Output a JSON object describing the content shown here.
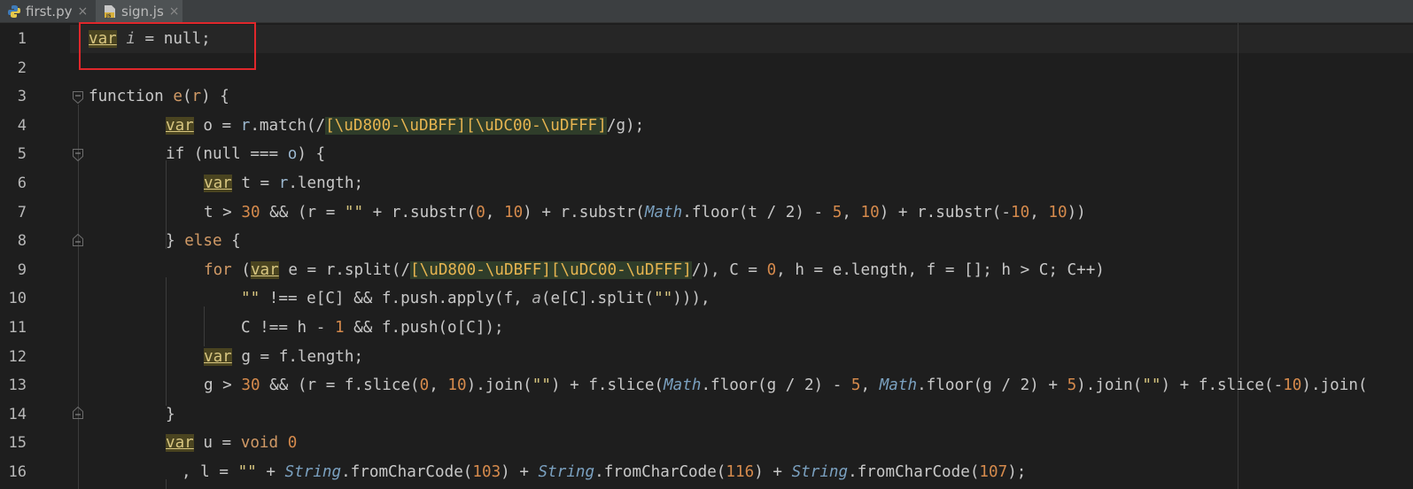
{
  "tabs": [
    {
      "label": "first.py",
      "icon": "python-file-icon",
      "close": "×",
      "active": false
    },
    {
      "label": "sign.js",
      "icon": "js-file-icon",
      "close": "×",
      "active": true
    }
  ],
  "line_numbers": [
    "1",
    "2",
    "3",
    "4",
    "5",
    "6",
    "7",
    "8",
    "9",
    "10",
    "11",
    "12",
    "13",
    "14",
    "15",
    "16"
  ],
  "code": {
    "l1": {
      "kw": "var",
      "id": "i",
      "rest": " = null;"
    },
    "l3": {
      "a": "function ",
      "b": "e",
      "c": "(",
      "d": "r",
      "e": ") {"
    },
    "l4": {
      "kw": "var",
      "a": " o = ",
      "b": "r",
      "c": ".match(/",
      "rx": "[\\uD800-\\uDBFF][\\uDC00-\\uDFFF]",
      "d": "/g);"
    },
    "l5": {
      "a": "if",
      "b": " (null === ",
      "c": "o",
      "d": ") {"
    },
    "l6": {
      "kw": "var",
      "a": " t = ",
      "b": "r",
      "c": ".length;"
    },
    "l7": {
      "a": "t > ",
      "n1": "30",
      "b": " && (r = ",
      "s1": "\"\"",
      "c": " + r.substr(",
      "n2": "0",
      "d": ", ",
      "n3": "10",
      "e": ") + r.substr(",
      "cls": "Math",
      "f": ".floor(t / 2) - ",
      "n4": "5",
      "g": ", ",
      "n5": "10",
      "h": ") + r.substr(-",
      "n6": "10",
      "i": ", ",
      "n7": "10",
      "j": "))"
    },
    "l8": {
      "a": "} ",
      "b": "else",
      "c": " {"
    },
    "l9": {
      "a": "for",
      "b": " (",
      "kw": "var",
      "c": " e = r.split(/",
      "rx": "[\\uD800-\\uDBFF][\\uDC00-\\uDFFF]",
      "d": "/), C = ",
      "n1": "0",
      "e": ", h = e.length, f = []; h > C; C++)"
    },
    "l10": {
      "s1": "\"\"",
      "a": " !== e[C] && f.push.apply(f, ",
      "it": "a",
      "b": "(e[C].split(",
      "s2": "\"\"",
      "c": "))),"
    },
    "l11": {
      "a": "C !== h - ",
      "n1": "1",
      "b": " && f.push(o[C]);"
    },
    "l12": {
      "kw": "var",
      "a": " g = f.length;"
    },
    "l13": {
      "a": "g > ",
      "n1": "30",
      "b": " && (r = f.slice(",
      "n2": "0",
      "c": ", ",
      "n3": "10",
      "d": ").join(",
      "s1": "\"\"",
      "e": ") + f.slice(",
      "cls1": "Math",
      "f": ".floor(g / 2) - ",
      "n4": "5",
      "g": ", ",
      "cls2": "Math",
      "h": ".floor(g / 2) + ",
      "n5": "5",
      "i": ").join(",
      "s2": "\"\"",
      "j": ") + f.slice(-",
      "n6": "10",
      "k": ").join("
    },
    "l14": {
      "a": "}"
    },
    "l15": {
      "kw": "var",
      "a": " u = ",
      "b": "void",
      "c": " ",
      "n1": "0"
    },
    "l16": {
      "a": ", l = ",
      "s1": "\"\"",
      "b": " + ",
      "cls1": "String",
      "c": ".fromCharCode(",
      "n1": "103",
      "d": ") + ",
      "cls2": "String",
      "e": ".fromCharCode(",
      "n2": "116",
      "f": ") + ",
      "cls3": "String",
      "g": ".fromCharCode(",
      "n3": "107",
      "h": ");"
    }
  }
}
